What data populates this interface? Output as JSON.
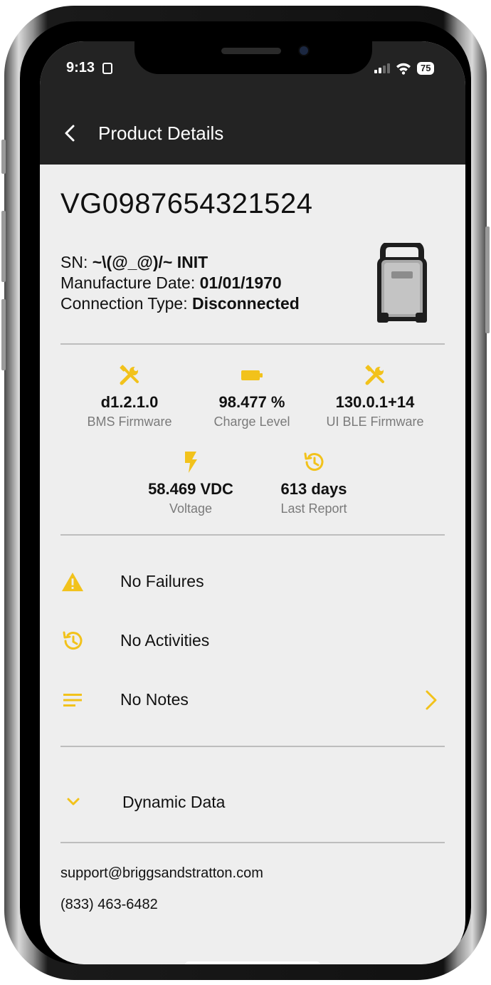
{
  "colors": {
    "accent": "#f2c21b",
    "header_bg": "#232323",
    "screen_bg": "#eeeeee"
  },
  "status_bar": {
    "time": "9:13",
    "battery": "75"
  },
  "header": {
    "title": "Product Details",
    "back_icon": "chevron-left-icon"
  },
  "product": {
    "id": "VG0987654321524",
    "sn_label": "SN:",
    "sn_value": "~\\(@_@)/~ INIT",
    "manufacture_label": "Manufacture Date:",
    "manufacture_value": "01/01/1970",
    "connection_label": "Connection Type:",
    "connection_value": "Disconnected"
  },
  "stats": [
    {
      "icon": "tools-icon",
      "value": "d1.2.1.0",
      "label": "BMS Firmware"
    },
    {
      "icon": "battery-icon",
      "value": "98.477 %",
      "label": "Charge Level"
    },
    {
      "icon": "tools-icon",
      "value": "130.0.1+14",
      "label": "UI BLE Firmware"
    },
    {
      "icon": "lightning-icon",
      "value": "58.469 VDC",
      "label": "Voltage"
    },
    {
      "icon": "history-icon",
      "value": "613 days",
      "label": "Last Report"
    }
  ],
  "list": [
    {
      "icon": "warning-icon",
      "label": "No Failures"
    },
    {
      "icon": "history-icon",
      "label": "No Activities"
    },
    {
      "icon": "notes-icon",
      "label": "No Notes"
    }
  ],
  "dynamic_data": {
    "label": "Dynamic Data",
    "icon": "chevron-down-icon"
  },
  "contact": {
    "email": "support@briggsandstratton.com",
    "phone": "(833) 463-6482"
  }
}
